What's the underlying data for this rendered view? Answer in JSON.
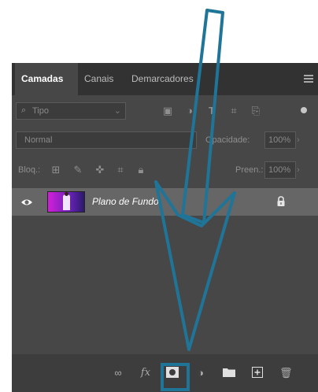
{
  "tabs": [
    {
      "label": "Camadas",
      "active": true
    },
    {
      "label": "Canais",
      "active": false
    },
    {
      "label": "Demarcadores",
      "active": false
    }
  ],
  "filter": {
    "label": "Tipo"
  },
  "blend": {
    "mode": "Normal",
    "opacity_label": "Opacidade:",
    "opacity_value": "100%"
  },
  "lock": {
    "label": "Bloq.:",
    "fill_label": "Preen.:",
    "fill_value": "100%"
  },
  "layer": {
    "name": "Plano de Fundo"
  },
  "footer": {
    "fx_label": "fx"
  },
  "colors": {
    "panel": "#474747",
    "tabbar": "#323232",
    "layer_selected": "#666666",
    "arrow": "#1f7497"
  }
}
